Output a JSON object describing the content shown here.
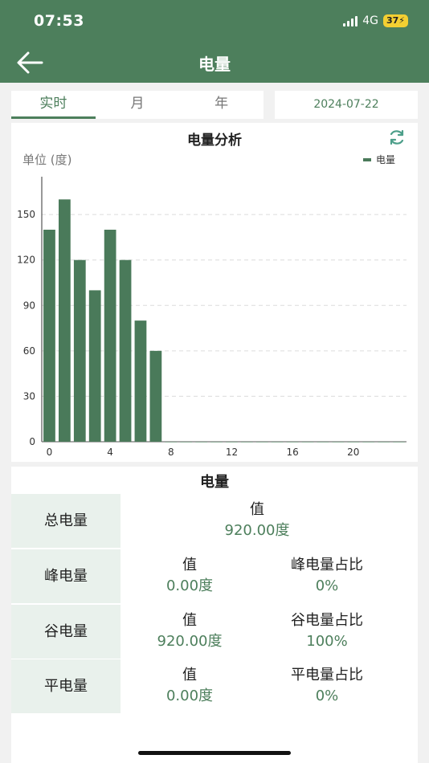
{
  "status": {
    "time": "07:53",
    "network": "4G",
    "battery": "37"
  },
  "header": {
    "title": "电量"
  },
  "tabs": [
    {
      "label": "实时"
    },
    {
      "label": "月"
    },
    {
      "label": "年"
    }
  ],
  "date": "2024-07-22",
  "chart": {
    "title": "电量分析",
    "unit": "单位 (度)",
    "legend": "电量"
  },
  "chart_data": {
    "type": "bar",
    "title": "电量分析",
    "ylabel": "单位 (度)",
    "x_ticks": [
      0,
      4,
      8,
      12,
      16,
      20
    ],
    "y_ticks": [
      0,
      30,
      60,
      90,
      120,
      150
    ],
    "xlim": [
      -0.5,
      23.5
    ],
    "ylim": [
      0,
      175
    ],
    "series": [
      {
        "name": "电量",
        "color": "#4a7a5a",
        "x": [
          0,
          1,
          2,
          3,
          4,
          5,
          6,
          7,
          8,
          9,
          10,
          11,
          12,
          13,
          14,
          15,
          16,
          17,
          18,
          19,
          20,
          21,
          22,
          23
        ],
        "values": [
          140,
          160,
          120,
          100,
          140,
          120,
          80,
          60,
          0,
          0,
          0,
          0,
          0,
          0,
          0,
          0,
          0,
          0,
          0,
          0,
          0,
          0,
          0,
          0
        ]
      }
    ],
    "grid": "horizontal-dashed",
    "legend_position": "top-right"
  },
  "table": {
    "title": "电量",
    "rows": [
      {
        "label": "总电量",
        "c1_name": "值",
        "c1_value": "920.00度"
      },
      {
        "label": "峰电量",
        "c1_name": "值",
        "c1_value": "0.00度",
        "c2_name": "峰电量占比",
        "c2_value": "0%"
      },
      {
        "label": "谷电量",
        "c1_name": "值",
        "c1_value": "920.00度",
        "c2_name": "谷电量占比",
        "c2_value": "100%"
      },
      {
        "label": "平电量",
        "c1_name": "值",
        "c1_value": "0.00度",
        "c2_name": "平电量占比",
        "c2_value": "0%"
      }
    ]
  },
  "colors": {
    "brand": "#4d7f5c",
    "bar": "#4a7a5a",
    "row_label_bg": "#e9f1ec"
  }
}
